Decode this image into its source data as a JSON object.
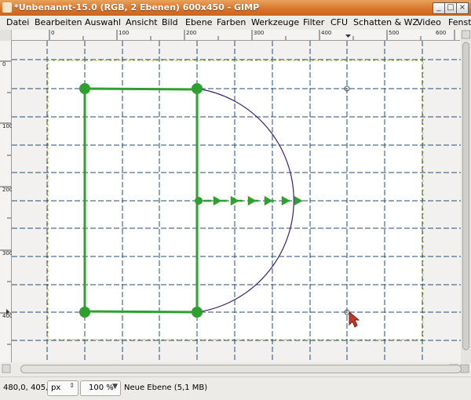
{
  "window": {
    "title": "*Unbenannt-15.0 (RGB, 2 Ebenen) 600x450 - GIMP",
    "controls": {
      "minimize": "_",
      "maximize": "□",
      "close": "×"
    }
  },
  "menubar": {
    "items": [
      "Datei",
      "Bearbeiten",
      "Auswahl",
      "Ansicht",
      "Bild",
      "Ebene",
      "Farben",
      "Werkzeuge",
      "Filter",
      "CFU",
      "Schatten & WZ",
      "Video",
      "Fenst"
    ]
  },
  "rulers": {
    "horizontal": [
      "0",
      "100",
      "200",
      "300",
      "400",
      "500",
      "600"
    ],
    "vertical": [
      "0",
      "100",
      "200",
      "300",
      "400"
    ]
  },
  "status": {
    "coords": "480,0, 405,0",
    "unit": "px",
    "zoom": "100 %",
    "message": "Neue Ebene (5,1 MB)"
  },
  "colors": {
    "path": "#2ea02e",
    "arc": "#3b1f66",
    "guide": "#1f4e79",
    "layer_boundary": "#c8b400"
  }
}
